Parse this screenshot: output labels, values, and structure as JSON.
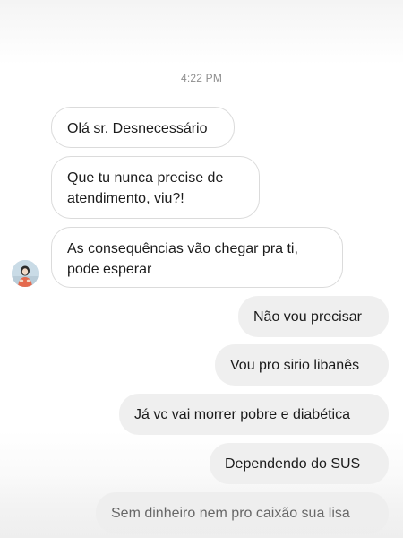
{
  "timestamp": "4:22 PM",
  "incoming_messages": [
    "Olá sr. Desnecessário",
    "Que tu nunca precise de\natendimento, viu?!",
    "As consequências vão chegar pra ti,\npode esperar"
  ],
  "outgoing_messages": [
    "Não vou precisar",
    "Vou pro sirio libanês",
    "Já vc vai morrer pobre e diabética",
    "Dependendo do SUS",
    "Sem dinheiro nem pro caixão sua lisa"
  ],
  "avatar": {
    "icon": "profile-photo-avatar",
    "colors": [
      "#c9dbe6",
      "#e46a4e",
      "#2b2b2b",
      "#f1d9c6"
    ]
  },
  "colors": {
    "incoming_bg": "#ffffff",
    "incoming_border": "#dbdbdb",
    "outgoing_bg": "#efefef",
    "timestamp": "#8e8e8e",
    "text": "#1b1b1b"
  }
}
